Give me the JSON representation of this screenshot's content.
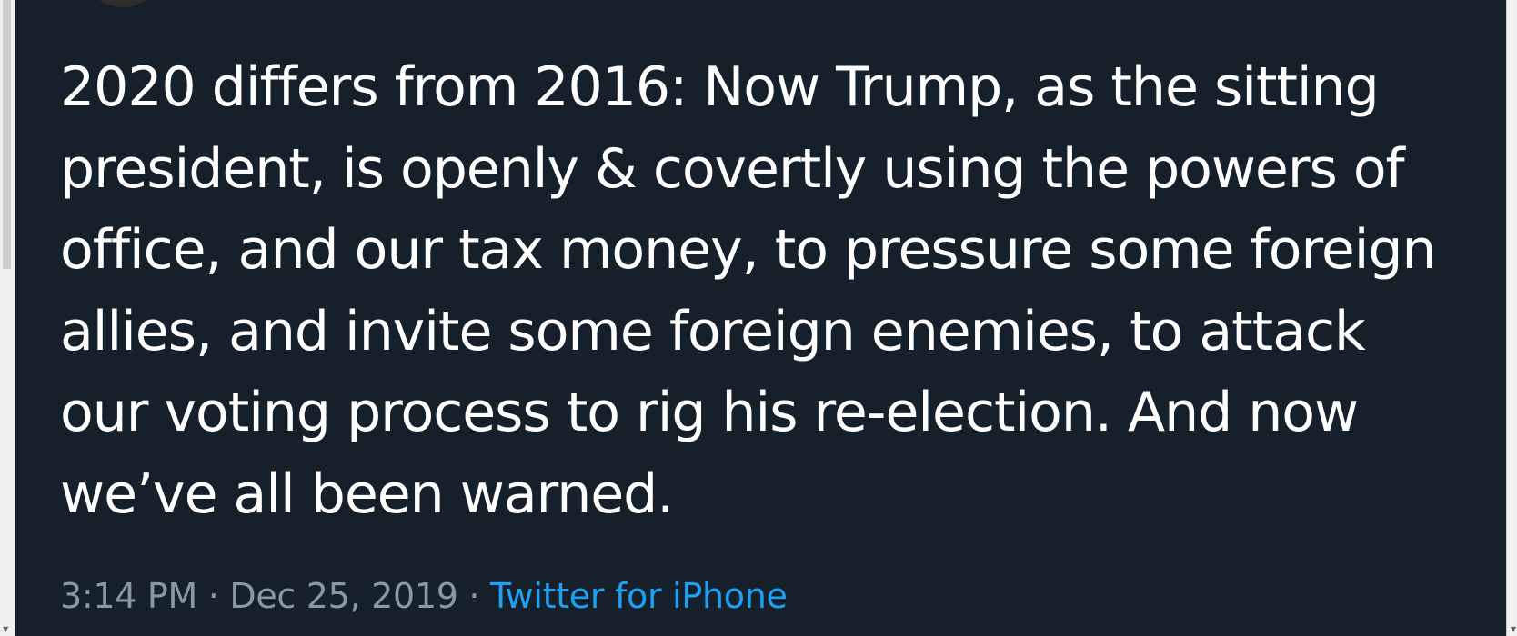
{
  "tweet": {
    "text": "2020 differs from 2016: Now Trump, as the sitting president, is openly & covertly using the powers of office, and our tax money, to pressure some foreign allies, and invite some foreign enemies, to attack our voting process to rig his re-election. And now we’ve all been warned.",
    "time": "3:14 PM",
    "date": "Dec 25, 2019",
    "separator": "·",
    "source": "Twitter for iPhone"
  },
  "colors": {
    "background": "#15202b",
    "text": "#ffffff",
    "meta_text": "#8899a6",
    "link": "#1da1f2"
  },
  "icons": {
    "scroll_down_arrow": "triangle-down"
  }
}
